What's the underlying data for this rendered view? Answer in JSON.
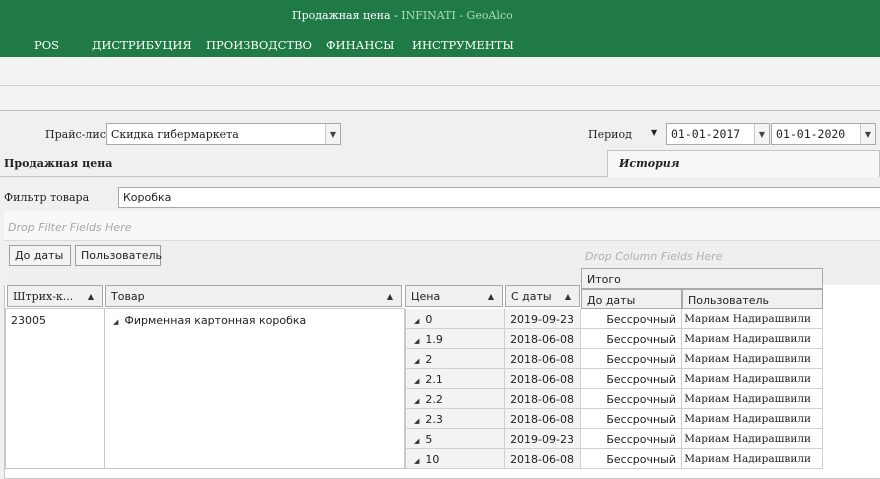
{
  "window": {
    "title_prefix": "Продажная цена - ",
    "app_name": "INFINATI - GeoAlco"
  },
  "menu": [
    "POS",
    "ДИСТРИБУЦИЯ",
    "ПРОИЗВОДСТВО",
    "ФИНАНСЫ",
    "ИНСТРУМЕНТЫ"
  ],
  "price_list": {
    "label": "Прайс-лист",
    "value": "Скидка гибермаркета"
  },
  "period": {
    "label": "Период",
    "from": "01-01-2017",
    "to": "01-01-2020"
  },
  "tabs": {
    "sale_price": "Продажная цена",
    "history": "История"
  },
  "filter": {
    "label": "Фильтр товара",
    "value": "Коробка"
  },
  "pivot": {
    "filter_drop_hint": "Drop Filter Fields Here",
    "column_drop_hint": "Drop Column Fields Here",
    "row_field_buttons": [
      "До даты",
      "Пользователь"
    ],
    "headers": {
      "barcode": "Штрих-к...",
      "product": "Товар",
      "price": "Цена",
      "from_date": "С даты",
      "total": "Итого",
      "to_date": "До даты",
      "user": "Пользователь"
    },
    "barcode": "23005",
    "product": "Фирменная картонная коробка",
    "rows": [
      {
        "price": "0",
        "from_date": "2019-09-23",
        "to_date": "Бессрочный",
        "user": "Мариам Надирашвили"
      },
      {
        "price": "1.9",
        "from_date": "2018-06-08",
        "to_date": "Бессрочный",
        "user": "Мариам Надирашвили"
      },
      {
        "price": "2",
        "from_date": "2018-06-08",
        "to_date": "Бессрочный",
        "user": "Мариам Надирашвили"
      },
      {
        "price": "2.1",
        "from_date": "2018-06-08",
        "to_date": "Бессрочный",
        "user": "Мариам Надирашвили"
      },
      {
        "price": "2.2",
        "from_date": "2018-06-08",
        "to_date": "Бессрочный",
        "user": "Мариам Надирашвили"
      },
      {
        "price": "2.3",
        "from_date": "2018-06-08",
        "to_date": "Бессрочный",
        "user": "Мариам Надирашвили"
      },
      {
        "price": "5",
        "from_date": "2019-09-23",
        "to_date": "Бессрочный",
        "user": "Мариам Надирашвили"
      },
      {
        "price": "10",
        "from_date": "2018-06-08",
        "to_date": "Бессрочный",
        "user": "Мариам Надирашвили"
      }
    ]
  },
  "colors": {
    "header_green": "#1f7a45",
    "app_name_green": "#a8dfb9"
  }
}
